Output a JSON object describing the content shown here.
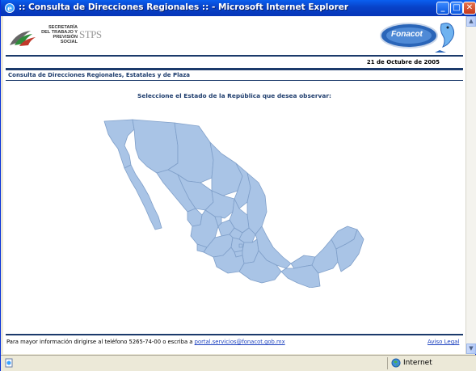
{
  "window": {
    "title": ":: Consulta de Direcciones Regionales :: - Microsoft Internet Explorer",
    "minimize": "_",
    "maximize": "□",
    "close": "✕"
  },
  "header": {
    "stps_org_name": "SECRETARÍA DEL TRABAJO Y PREVISIÓN SOCIAL",
    "stps_abbr": "STPS",
    "fonacot_logo": "Fonacot",
    "date": "21 de Octubre de 2005"
  },
  "page": {
    "section_title": "Consulta de Direcciones Regionales, Estatales y de Plaza",
    "prompt": "Seleccione el Estado de la República que desea observar:",
    "map_fill": "#a9c4e6",
    "map_stroke": "#7f9fc9"
  },
  "footer": {
    "info_text": "Para mayor información dirigirse al teléfono 5265-74-00 o escriba a ",
    "email": "portal.servicios@fonacot.gob.mx",
    "legal_link": "Aviso Legal"
  },
  "statusbar": {
    "zone": "Internet"
  }
}
